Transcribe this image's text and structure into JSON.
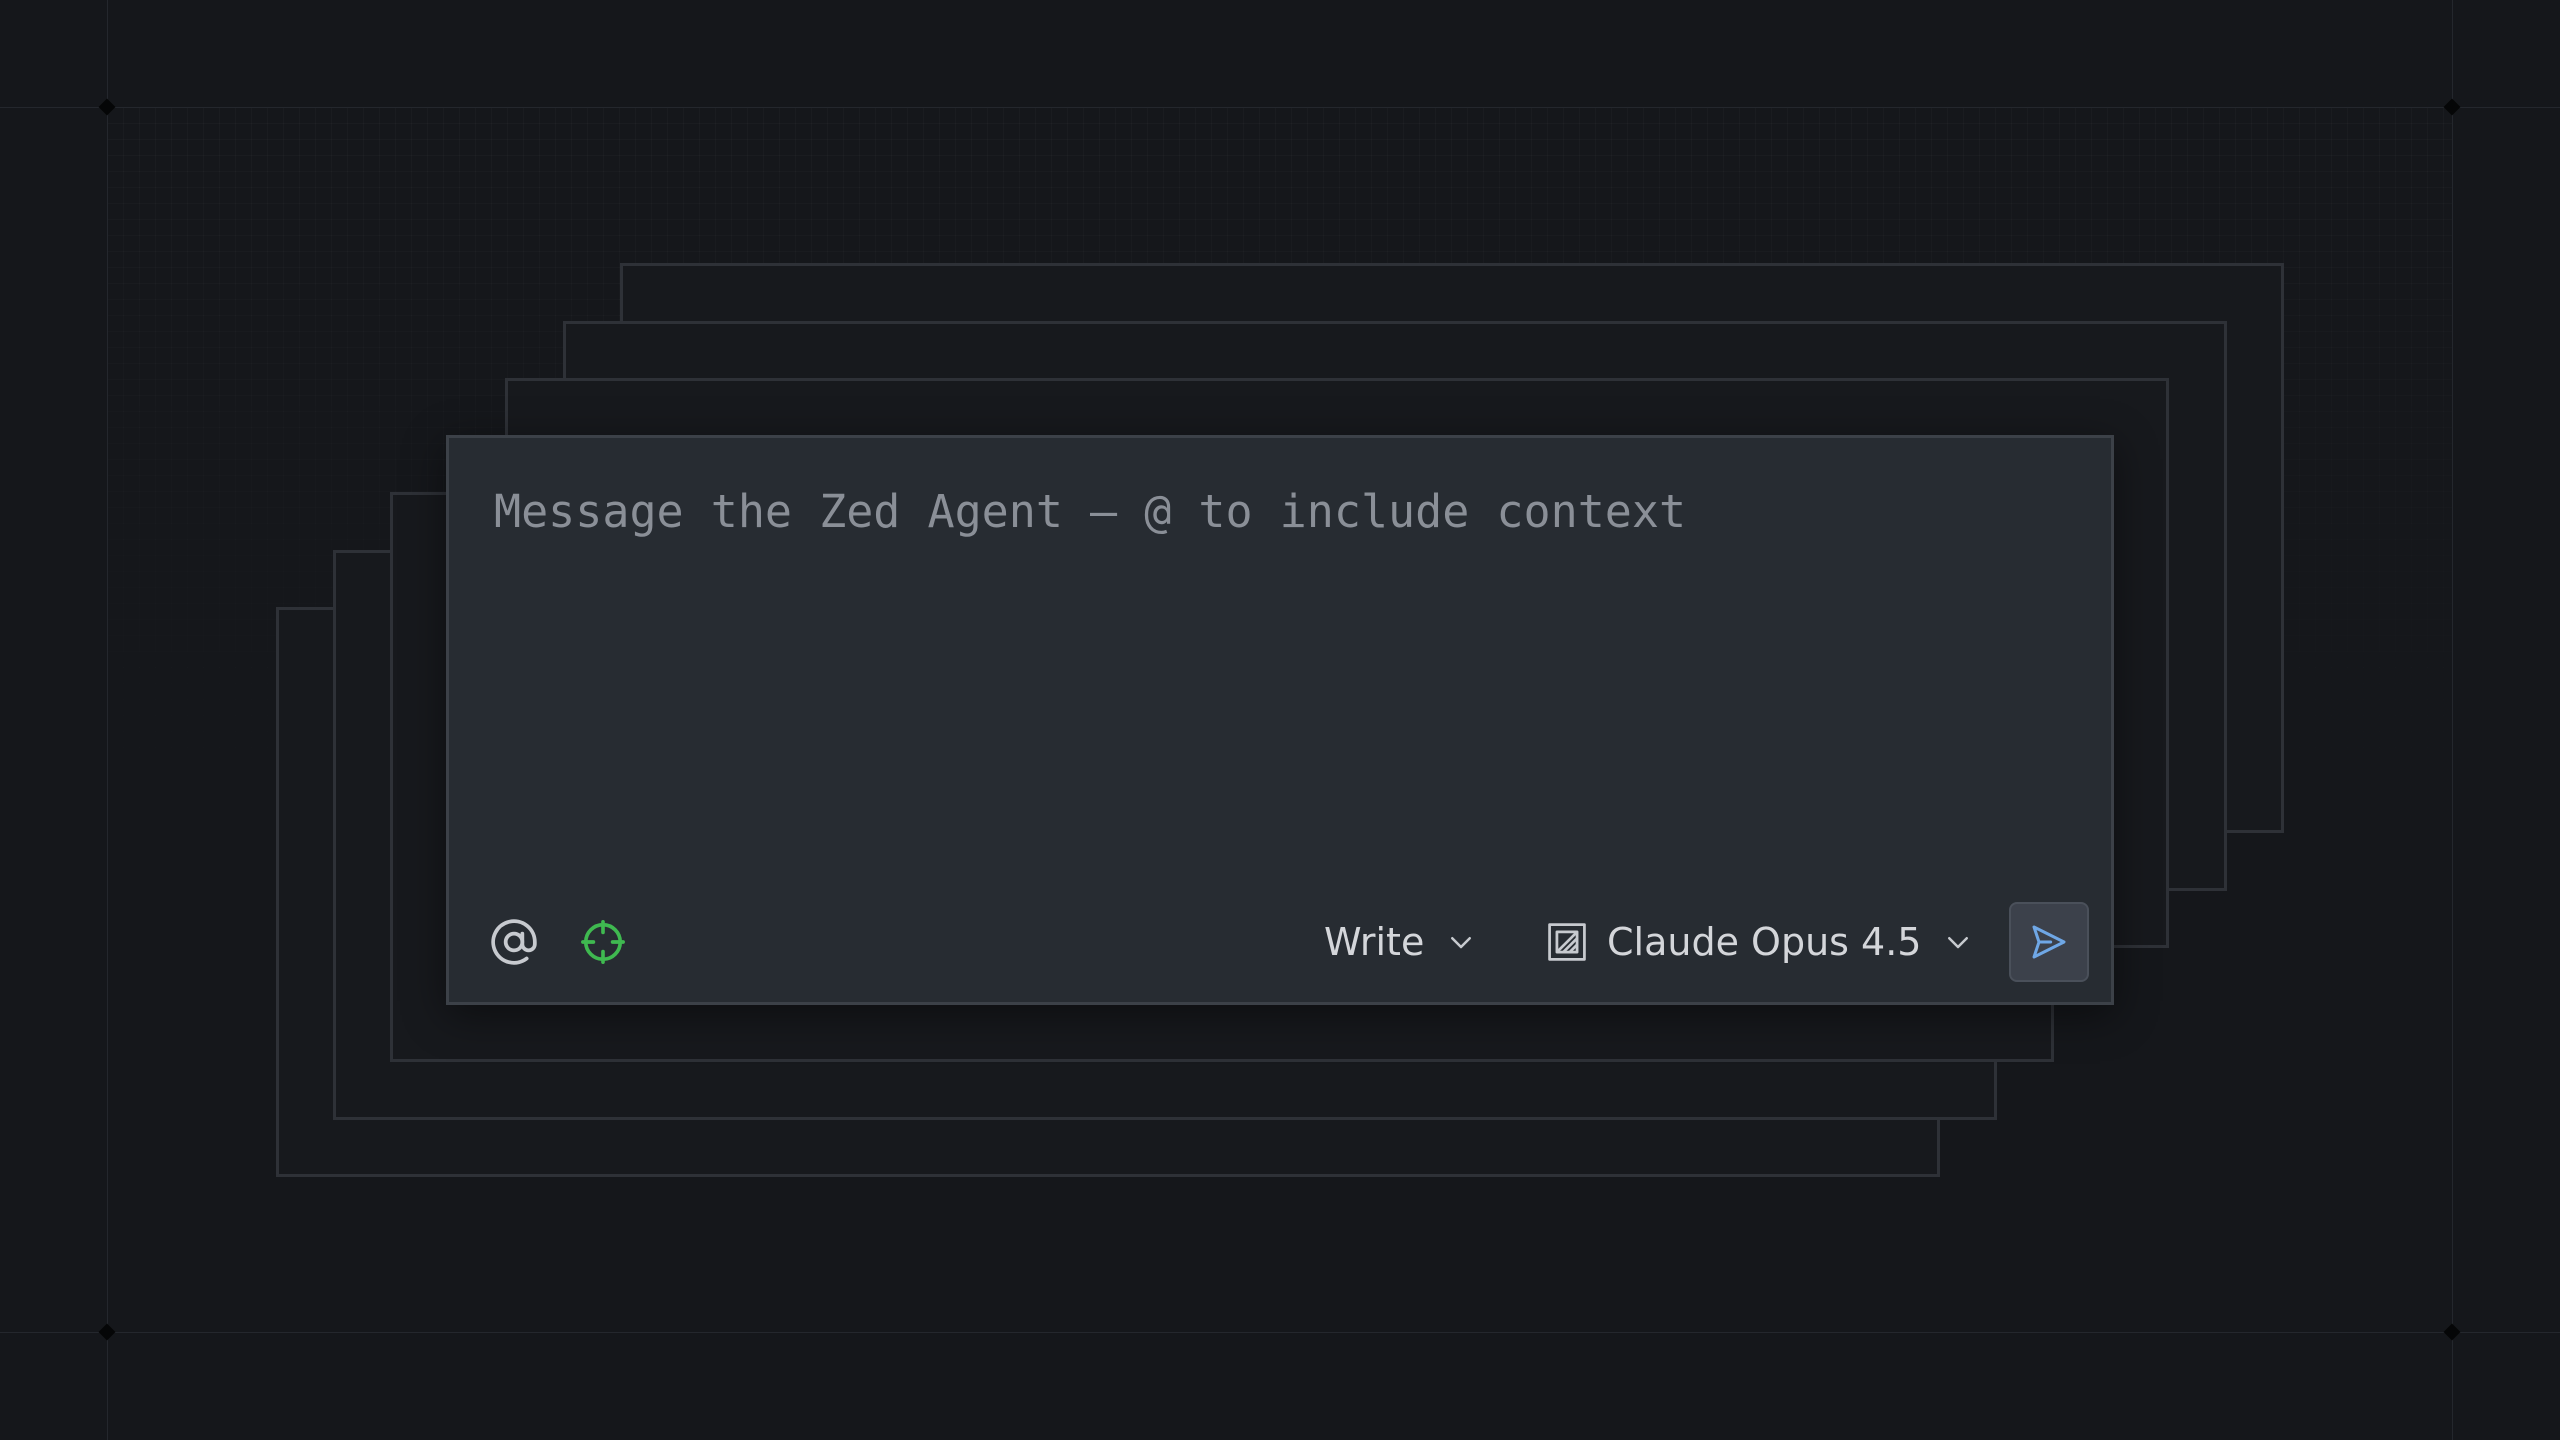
{
  "composer": {
    "placeholder": "Message the Zed Agent — @ to include context",
    "value": ""
  },
  "toolbar": {
    "mention_icon": "at-icon",
    "context_icon": "crosshair-icon",
    "mode_label": "Write",
    "mode_icon": "chevron-down-icon",
    "model_label": "Claude Opus 4.5",
    "model_icon": "model-icon",
    "send_icon": "send-icon"
  },
  "colors": {
    "background": "#15171b",
    "composer_bg": "#272c32",
    "accent_green": "#3fb950",
    "accent_blue": "#6fa7e6",
    "text": "#d4d6da",
    "placeholder": "#8a8f97"
  }
}
